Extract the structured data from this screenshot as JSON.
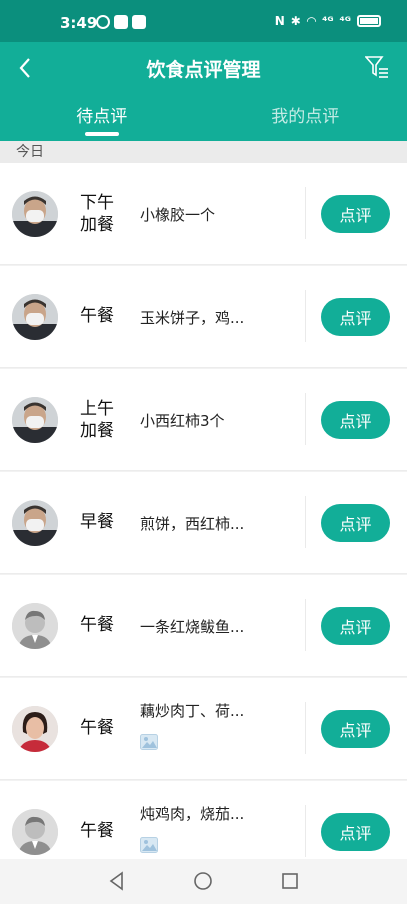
{
  "status_bar": {
    "time": "3:49",
    "signal_1": "⁴ᴳ",
    "signal_2": "⁴ᴳ"
  },
  "header": {
    "title": "饮食点评管理",
    "tabs": [
      {
        "label": "待点评",
        "active": true
      },
      {
        "label": "我的点评",
        "active": false
      }
    ]
  },
  "section": {
    "label": "今日"
  },
  "review_button_label": "点评",
  "meals": [
    {
      "meal_type": "下午\n加餐",
      "description": "小橡胶一个",
      "has_photo": false,
      "avatar": "man-mask"
    },
    {
      "meal_type": "午餐",
      "description": "玉米饼子，鸡...",
      "has_photo": false,
      "avatar": "man-mask"
    },
    {
      "meal_type": "上午\n加餐",
      "description": "小西红柿3个",
      "has_photo": false,
      "avatar": "man-mask"
    },
    {
      "meal_type": "早餐",
      "description": "煎饼，西红柿...",
      "has_photo": false,
      "avatar": "man-mask"
    },
    {
      "meal_type": "午餐",
      "description": "一条红烧鲅鱼...",
      "has_photo": false,
      "avatar": "default-person"
    },
    {
      "meal_type": "午餐",
      "description": "藕炒肉丁、荷...",
      "has_photo": true,
      "avatar": "woman"
    },
    {
      "meal_type": "午餐",
      "description": "炖鸡肉，烧茄...",
      "has_photo": true,
      "avatar": "default-person"
    }
  ],
  "colors": {
    "primary": "#12ae98",
    "status_bar": "#0b8f7d"
  },
  "icons": {
    "back": "chevron-left-icon",
    "filter": "filter-icon",
    "photo": "image-icon"
  }
}
